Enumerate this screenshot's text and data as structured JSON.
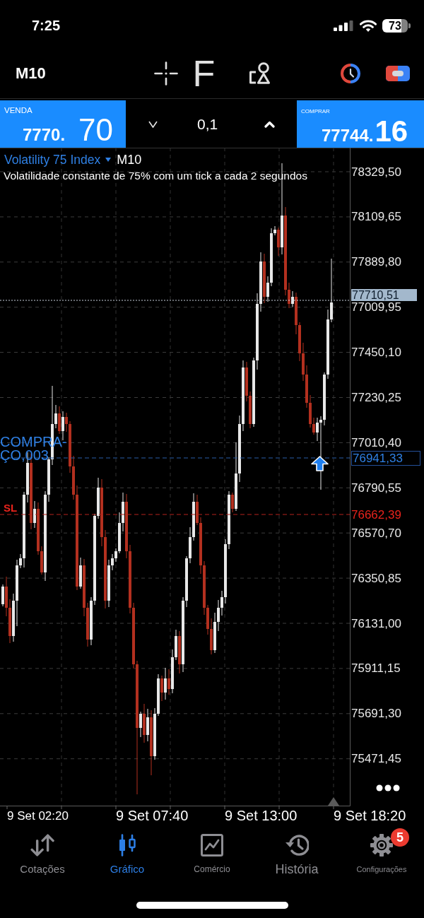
{
  "status_bar": {
    "time": "7:25",
    "battery": "73"
  },
  "toolbar": {
    "timeframe": "M10",
    "indicators_label": "F"
  },
  "trade_panel": {
    "sell": {
      "label": "VENDA",
      "price": "7770.",
      "price_large": "70"
    },
    "volume": "0,1",
    "buy": {
      "label": "COMPRAR",
      "price": "77744.",
      "price_large": "16"
    }
  },
  "chart": {
    "symbol": "Volatility 75 Index",
    "timeframe": "M10",
    "description": "Volatilidade constante de 75% com um tick a cada 2 segundos",
    "price_labels": [
      "78329,50",
      "78109,65",
      "77889,80",
      "77009,95",
      "77450,10",
      "77230,25",
      "77010,40",
      "76790,55",
      "76570,70",
      "76350,85",
      "76131,00",
      "75911,15",
      "75691,30",
      "75471,45"
    ],
    "current_price": "77710,51",
    "position": {
      "label": "COMPRA-ÇO,003",
      "price": "76941,33"
    },
    "stop_loss": {
      "label": "SL",
      "price": "76662,39"
    },
    "time_labels": [
      "9 Set 02:20",
      "9 Set 07:40",
      "9 Set 13:00",
      "9 Set 18:20"
    ]
  },
  "tab_bar": {
    "tabs": [
      {
        "label": "Cotações",
        "selected": false
      },
      {
        "label": "Gráfico",
        "selected": true
      },
      {
        "label": "Comércio",
        "selected": false
      },
      {
        "label": "História",
        "selected": false
      },
      {
        "label": "Configurações",
        "selected": false,
        "badge": "5"
      }
    ]
  }
}
